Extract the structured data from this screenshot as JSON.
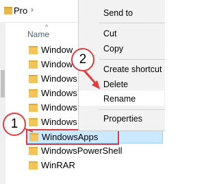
{
  "breadcrumb": {
    "folder": "Pro",
    "separator": "›"
  },
  "header": {
    "name_label": "Name",
    "sort_glyph": "^"
  },
  "files": [
    {
      "name": "Window",
      "selected": false
    },
    {
      "name": "Windows",
      "selected": false
    },
    {
      "name": "Windows I",
      "selected": false
    },
    {
      "name": "Windows I",
      "selected": false
    },
    {
      "name": "Windows I",
      "selected": false
    },
    {
      "name": "Windows S",
      "selected": false
    },
    {
      "name": "WindowsApps",
      "selected": true
    },
    {
      "name": "WindowsPowerShell",
      "selected": false
    },
    {
      "name": "WinRAR",
      "selected": false
    }
  ],
  "context_menu": {
    "send_to": "Send to",
    "cut": "Cut",
    "copy": "Copy",
    "create_shortcut": "Create shortcut",
    "delete": "Delete",
    "rename": "Rename",
    "properties": "Properties"
  },
  "annotations": {
    "step1": "1",
    "step2": "2",
    "color": "#e33b3b"
  },
  "colors": {
    "selection": "#cce8ff",
    "folder": "#f2c55c",
    "menu_bg": "#f2f2f2"
  },
  "icons": {
    "folder": "folder-icon",
    "submenu": "chevron-right-icon"
  }
}
